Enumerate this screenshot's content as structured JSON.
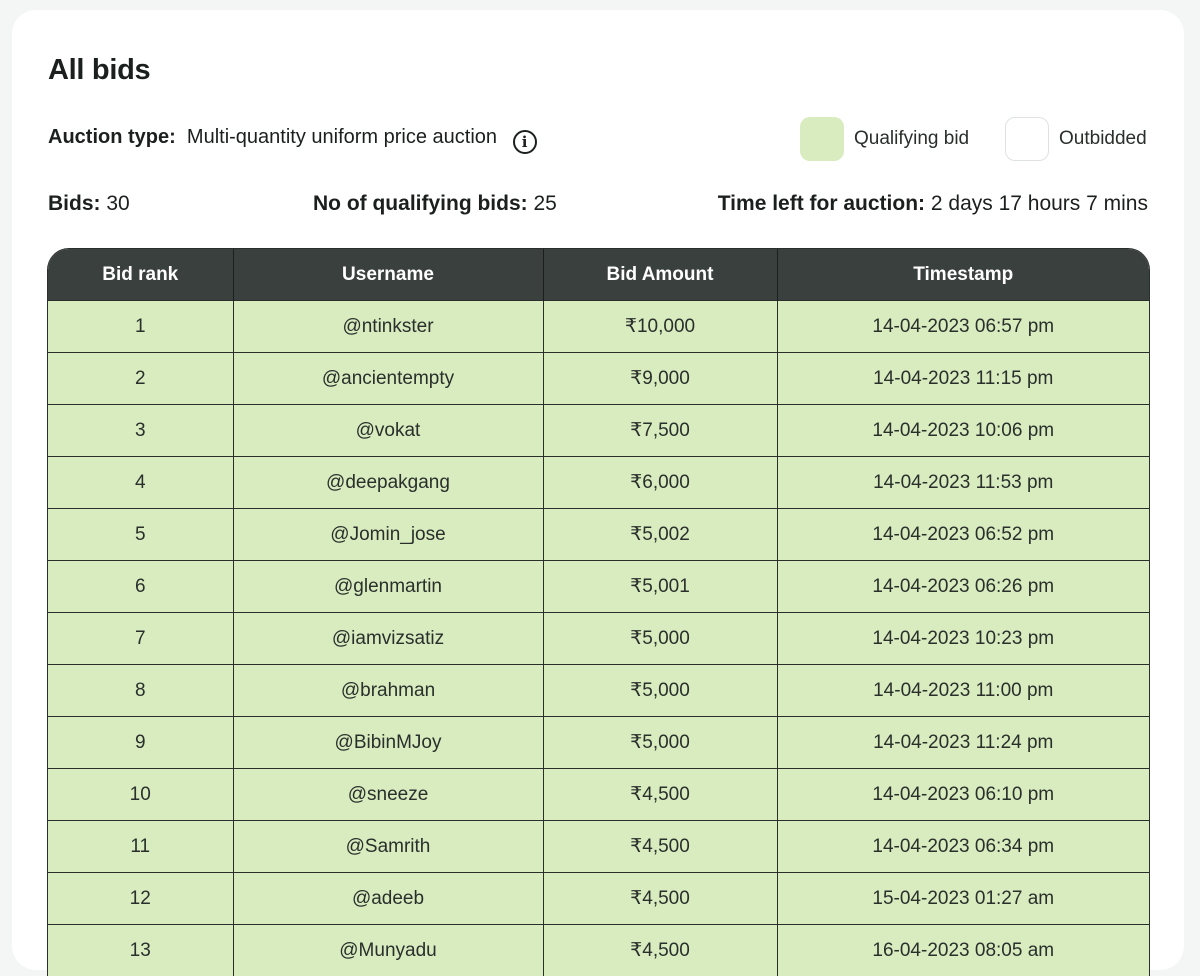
{
  "page": {
    "title": "All bids"
  },
  "auction": {
    "type_label": "Auction type:",
    "type_value": "Multi-quantity uniform price auction",
    "info_icon": "info-icon"
  },
  "legend": {
    "qualifying": {
      "label": "Qualifying bid",
      "color": "#d8ecbf"
    },
    "outbidded": {
      "label": "Outbidded",
      "color": "#ffffff"
    }
  },
  "stats": {
    "bids_label": "Bids:",
    "bids_value": "30",
    "qualifying_label": "No of qualifying bids:",
    "qualifying_value": "25",
    "time_label": "Time left for auction:",
    "time_value": "2 days 17 hours 7 mins"
  },
  "table": {
    "headers": [
      "Bid rank",
      "Username",
      "Bid Amount",
      "Timestamp"
    ],
    "rows": [
      [
        "1",
        "@ntinkster",
        "₹10,000",
        "14-04-2023 06:57 pm"
      ],
      [
        "2",
        "@ancientempty",
        "₹9,000",
        "14-04-2023 11:15 pm"
      ],
      [
        "3",
        "@vokat",
        "₹7,500",
        "14-04-2023 10:06 pm"
      ],
      [
        "4",
        "@deepakgang",
        "₹6,000",
        "14-04-2023 11:53 pm"
      ],
      [
        "5",
        "@Jomin_jose",
        "₹5,002",
        "14-04-2023 06:52 pm"
      ],
      [
        "6",
        "@glenmartin",
        "₹5,001",
        "14-04-2023 06:26 pm"
      ],
      [
        "7",
        "@iamvizsatiz",
        "₹5,000",
        "14-04-2023 10:23 pm"
      ],
      [
        "8",
        "@brahman",
        "₹5,000",
        "14-04-2023 11:00 pm"
      ],
      [
        "9",
        "@BibinMJoy",
        "₹5,000",
        "14-04-2023 11:24 pm"
      ],
      [
        "10",
        "@sneeze",
        "₹4,500",
        "14-04-2023 06:10 pm"
      ],
      [
        "11",
        "@Samrith",
        "₹4,500",
        "14-04-2023 06:34 pm"
      ],
      [
        "12",
        "@adeeb",
        "₹4,500",
        "15-04-2023 01:27 am"
      ],
      [
        "13",
        "@Munyadu",
        "₹4,500",
        "16-04-2023 08:05 am"
      ]
    ]
  }
}
